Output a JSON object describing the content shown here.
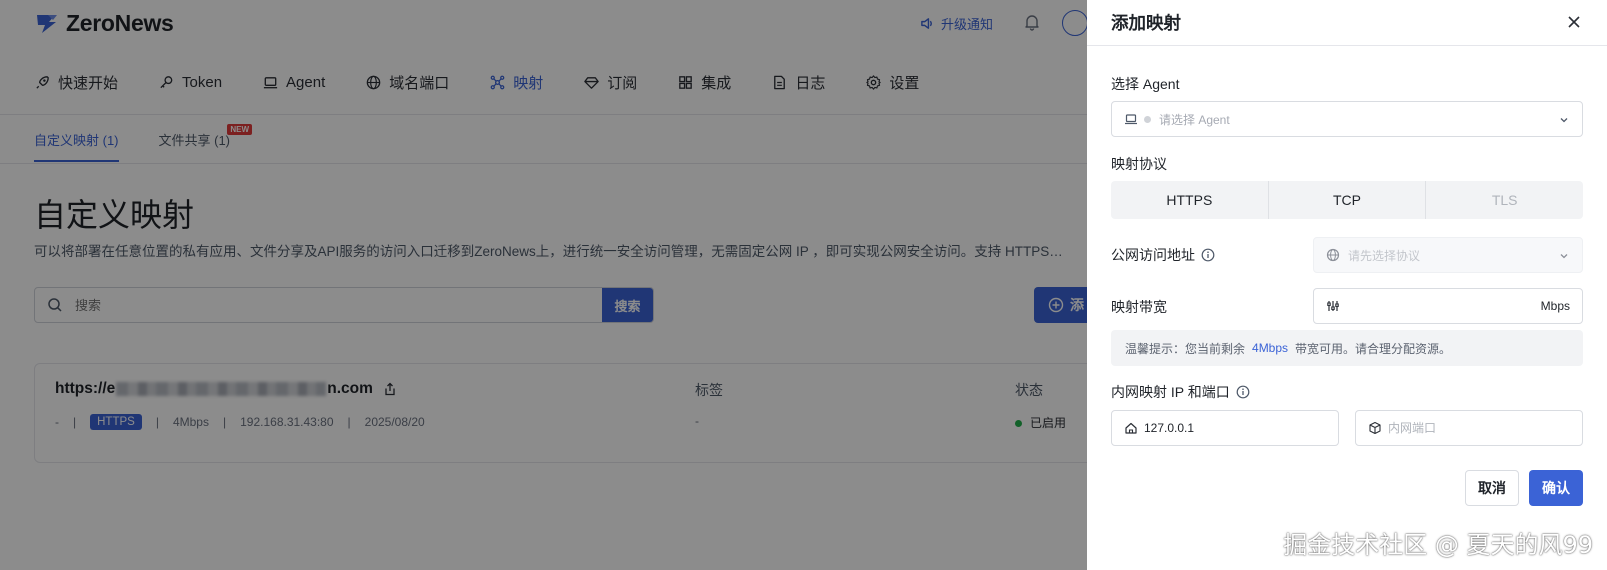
{
  "app": {
    "logo_text": "ZeroNews",
    "upgrade_notice": "升级通知"
  },
  "nav": {
    "items": [
      {
        "label": "快速开始",
        "icon": "rocket-icon"
      },
      {
        "label": "Token",
        "icon": "key-icon"
      },
      {
        "label": "Agent",
        "icon": "laptop-icon"
      },
      {
        "label": "域名端口",
        "icon": "globe-icon"
      },
      {
        "label": "映射",
        "icon": "network-icon",
        "active": true
      },
      {
        "label": "订阅",
        "icon": "diamond-icon"
      },
      {
        "label": "集成",
        "icon": "grid-icon"
      },
      {
        "label": "日志",
        "icon": "document-icon"
      },
      {
        "label": "设置",
        "icon": "gear-icon"
      }
    ]
  },
  "subtabs": {
    "custom": "自定义映射 (1)",
    "file_share": "文件共享 (1)",
    "new_badge": "NEW"
  },
  "page": {
    "title": "自定义映射",
    "description": "可以将部署在任意位置的私有应用、文件分享及API服务的访问入口迁移到ZeroNews上，进行统一安全访问管理，无需固定公网 IP ，即可实现公网安全访问。支持 HTTPS…",
    "search_placeholder": "搜索",
    "search_button": "搜索",
    "add_button": "添"
  },
  "mapping": {
    "url_prefix": "https://e",
    "url_suffix": "n.com",
    "dash": "-",
    "protocol": "HTTPS",
    "bandwidth": "4Mbps",
    "internal": "192.168.31.43:80",
    "date": "2025/08/20",
    "col_tags": "标签",
    "tags_value": "-",
    "col_status": "状态",
    "status_value": "已启用"
  },
  "drawer": {
    "title": "添加映射",
    "agent_label": "选择 Agent",
    "agent_placeholder": "请选择 Agent",
    "protocol_label": "映射协议",
    "protocols": [
      "HTTPS",
      "TCP",
      "TLS"
    ],
    "public_addr_label": "公网访问地址",
    "public_addr_placeholder": "请先选择协议",
    "bandwidth_label": "映射带宽",
    "bandwidth_unit": "Mbps",
    "tip_prefix": "温馨提示：您当前剩余",
    "tip_value": "4Mbps",
    "tip_suffix": "带宽可用。请合理分配资源。",
    "internal_label": "内网映射 IP 和端口",
    "internal_ip_value": "127.0.0.1",
    "internal_port_placeholder": "内网端口",
    "cancel": "取消",
    "confirm": "确认"
  },
  "watermark": "掘金技术社区 @ 夏天的风99",
  "colors": {
    "accent": "#3b63d6",
    "status_green": "#22b14c",
    "badge_red": "#e23b3b"
  }
}
